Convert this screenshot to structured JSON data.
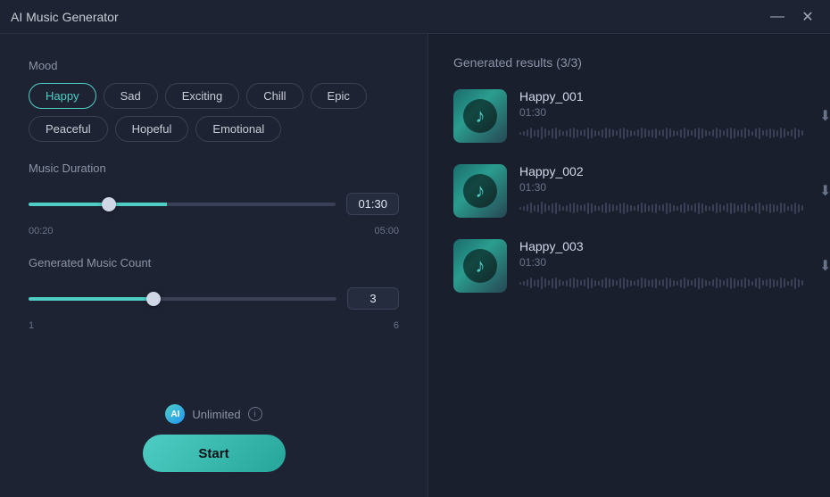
{
  "titleBar": {
    "title": "AI Music Generator",
    "minimizeIcon": "—",
    "closeIcon": "✕"
  },
  "leftPanel": {
    "mood": {
      "label": "Mood",
      "buttons": [
        {
          "id": "happy",
          "label": "Happy",
          "active": true
        },
        {
          "id": "sad",
          "label": "Sad",
          "active": false
        },
        {
          "id": "exciting",
          "label": "Exciting",
          "active": false
        },
        {
          "id": "chill",
          "label": "Chill",
          "active": false
        },
        {
          "id": "epic",
          "label": "Epic",
          "active": false
        },
        {
          "id": "peaceful",
          "label": "Peaceful",
          "active": false
        },
        {
          "id": "hopeful",
          "label": "Hopeful",
          "active": false
        },
        {
          "id": "emotional",
          "label": "Emotional",
          "active": false
        }
      ]
    },
    "duration": {
      "label": "Music Duration",
      "min": "00:20",
      "max": "05:00",
      "value": "01:30",
      "sliderMin": 20,
      "sliderMax": 300,
      "sliderValue": 90
    },
    "count": {
      "label": "Generated Music Count",
      "min": "1",
      "max": "6",
      "value": "3",
      "sliderMin": 1,
      "sliderMax": 6,
      "sliderValue": 3
    },
    "footer": {
      "aiBadge": "AI",
      "unlimited": "Unlimited",
      "infoIcon": "i",
      "startLabel": "Start"
    }
  },
  "rightPanel": {
    "resultsHeader": "Generated results (3/3)",
    "tracks": [
      {
        "name": "Happy_001",
        "time": "01:30"
      },
      {
        "name": "Happy_002",
        "time": "01:30"
      },
      {
        "name": "Happy_003",
        "time": "01:30"
      }
    ],
    "downloadIcon": "⬇",
    "moreIcon": "···"
  },
  "waveformBars": [
    3,
    5,
    8,
    12,
    7,
    9,
    14,
    10,
    6,
    11,
    13,
    8,
    5,
    7,
    10,
    12,
    9,
    6,
    8,
    13,
    11,
    7,
    5,
    9,
    12,
    10,
    8,
    6,
    11,
    13,
    9,
    7,
    5,
    8,
    12,
    10,
    7,
    9,
    11,
    6,
    8,
    13,
    10,
    7,
    5,
    9,
    12,
    8,
    6,
    10,
    13,
    11,
    7,
    5,
    8,
    12,
    9,
    6,
    10,
    13,
    11,
    7,
    9,
    12,
    8,
    5,
    10,
    13,
    6,
    8,
    11,
    9,
    7,
    12,
    10,
    5,
    8,
    13,
    9,
    6
  ]
}
